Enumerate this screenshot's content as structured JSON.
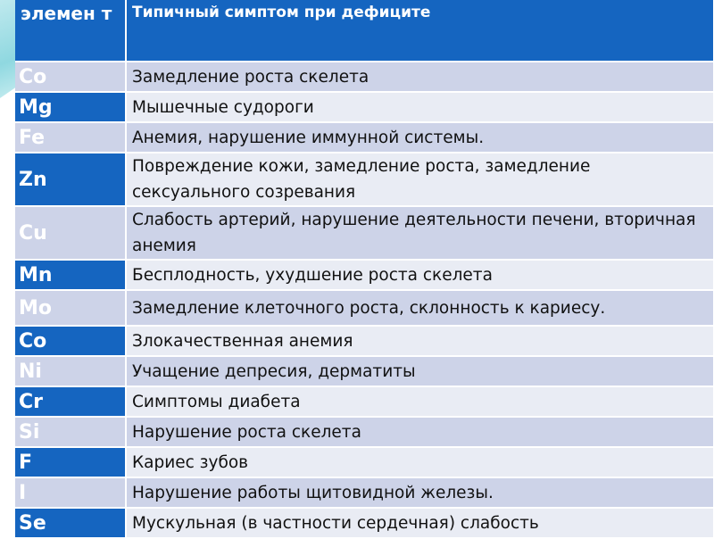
{
  "table": {
    "headers": [
      "элемен т",
      "Типичный симптом при дефиците"
    ],
    "rows": [
      {
        "element": "Co",
        "symptom": "Замедление роста скелета"
      },
      {
        "element": "Mg",
        "symptom": "Мышечные судороги"
      },
      {
        "element": "Fe",
        "symptom": "Анемия, нарушение иммунной системы."
      },
      {
        "element": "Zn",
        "symptom": "Повреждение кожи, замедление роста, замедление сексуального созревания"
      },
      {
        "element": "Cu",
        "symptom": "Слабость артерий, нарушение деятельности печени, вторичная анемия"
      },
      {
        "element": "Mn",
        "symptom": "Бесплодность, ухудшение роста скелета"
      },
      {
        "element": "Mo",
        "symptom": "Замедление клеточного роста, склонность к кариесу."
      },
      {
        "element": "Co",
        "symptom": "Злокачественная анемия"
      },
      {
        "element": "Ni",
        "symptom": "Учащение депресия, дерматиты"
      },
      {
        "element": "Cr",
        "symptom": "Симптомы диабета"
      },
      {
        "element": "Si",
        "symptom": "Нарушение роста скелета"
      },
      {
        "element": "F",
        "symptom": "Кариес зубов"
      },
      {
        "element": "I",
        "symptom": "Нарушение работы щитовидной железы."
      },
      {
        "element": "Se",
        "symptom": "Мускульная (в частности сердечная) слабость"
      }
    ]
  },
  "colors": {
    "header_bg": "#1565c0",
    "accent_row_element_bg": "#1565c0",
    "light_row_bg": "#cdd3e8",
    "pale_row_bg": "#e9ecf4"
  }
}
